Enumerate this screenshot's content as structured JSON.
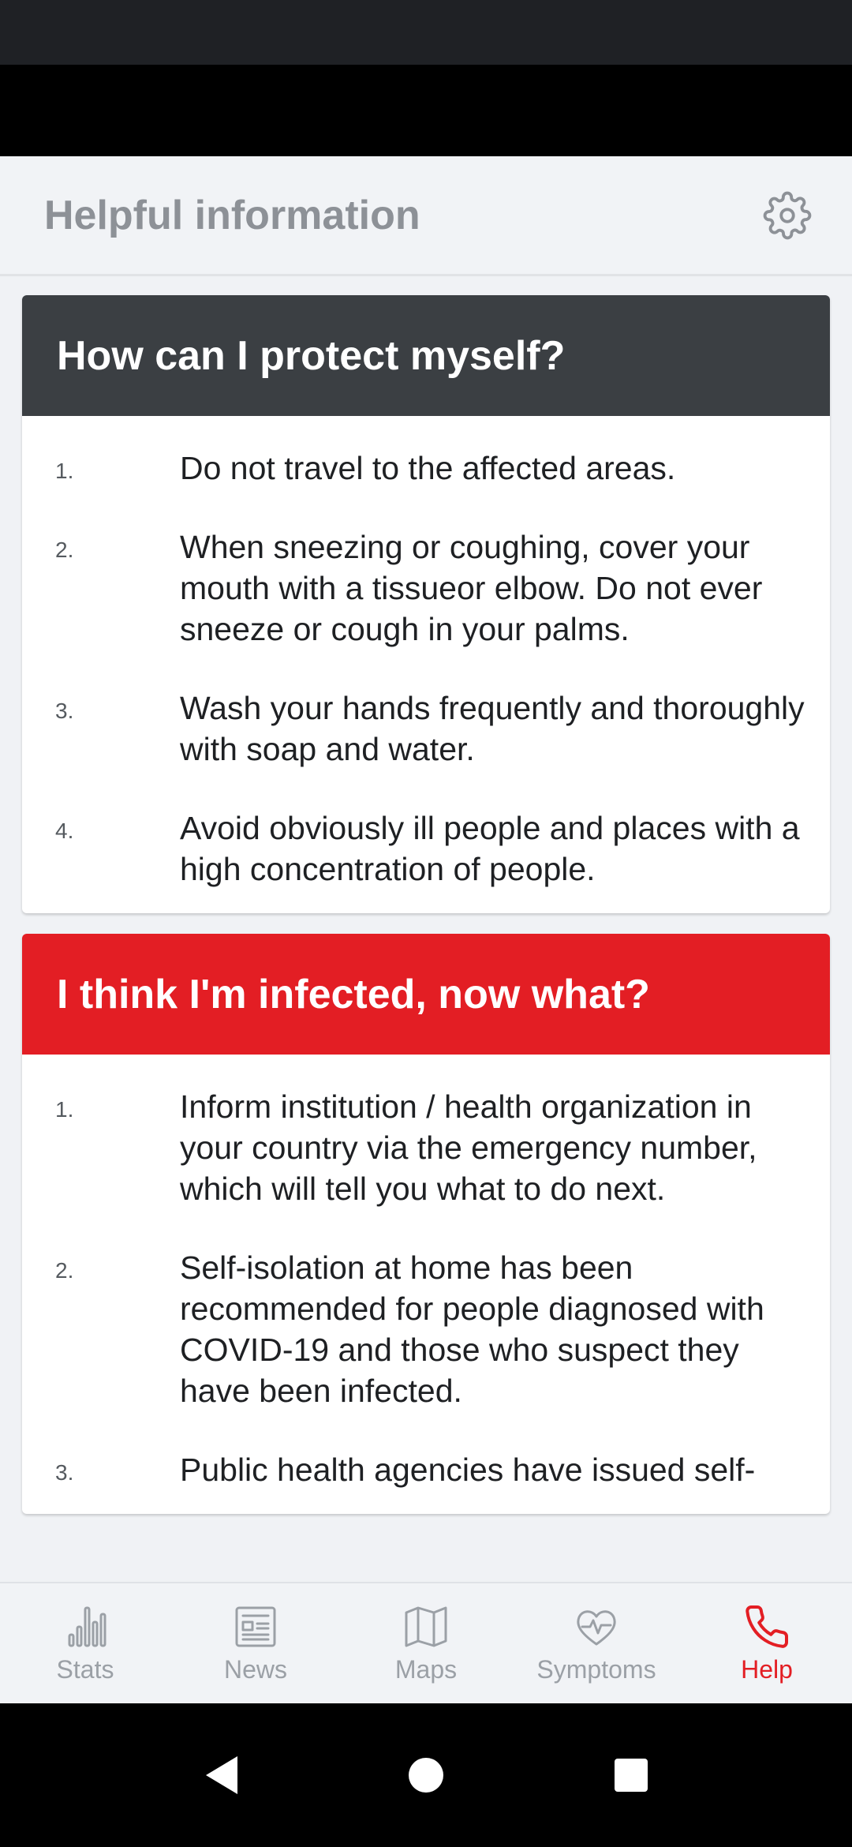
{
  "header": {
    "title": "Helpful information",
    "settings_icon": "gear-icon"
  },
  "cards": [
    {
      "title": "How can I protect myself?",
      "header_color": "#3b3f43",
      "items": [
        {
          "num": "1.",
          "text": "Do not travel to the affected areas."
        },
        {
          "num": "2.",
          "text": "When sneezing or coughing, cover your mouth with a tissueor elbow. Do not ever sneeze or cough in your palms."
        },
        {
          "num": "3.",
          "text": "Wash your hands frequently and thoroughly with soap and water."
        },
        {
          "num": "4.",
          "text": "Avoid obviously ill people and places with a high concentration of people."
        }
      ]
    },
    {
      "title": "I think I'm infected, now what?",
      "header_color": "#e31e24",
      "items": [
        {
          "num": "1.",
          "text": "Inform institution / health organization in your country via the emergency number, which will tell you what to do next."
        },
        {
          "num": "2.",
          "text": "Self-isolation at home has been recommended for people diagnosed with COVID-19 and those who suspect they have been infected."
        },
        {
          "num": "3.",
          "text": "Public health agencies have issued self-"
        }
      ]
    }
  ],
  "nav": {
    "items": [
      {
        "label": "Stats",
        "icon": "bar-chart-icon",
        "active": false
      },
      {
        "label": "News",
        "icon": "newspaper-icon",
        "active": false
      },
      {
        "label": "Maps",
        "icon": "map-icon",
        "active": false
      },
      {
        "label": "Symptoms",
        "icon": "heartbeat-icon",
        "active": false
      },
      {
        "label": "Help",
        "icon": "phone-icon",
        "active": true
      }
    ]
  },
  "colors": {
    "accent": "#e31e24",
    "dark_header": "#3b3f43",
    "inactive": "#9ba0a6"
  }
}
